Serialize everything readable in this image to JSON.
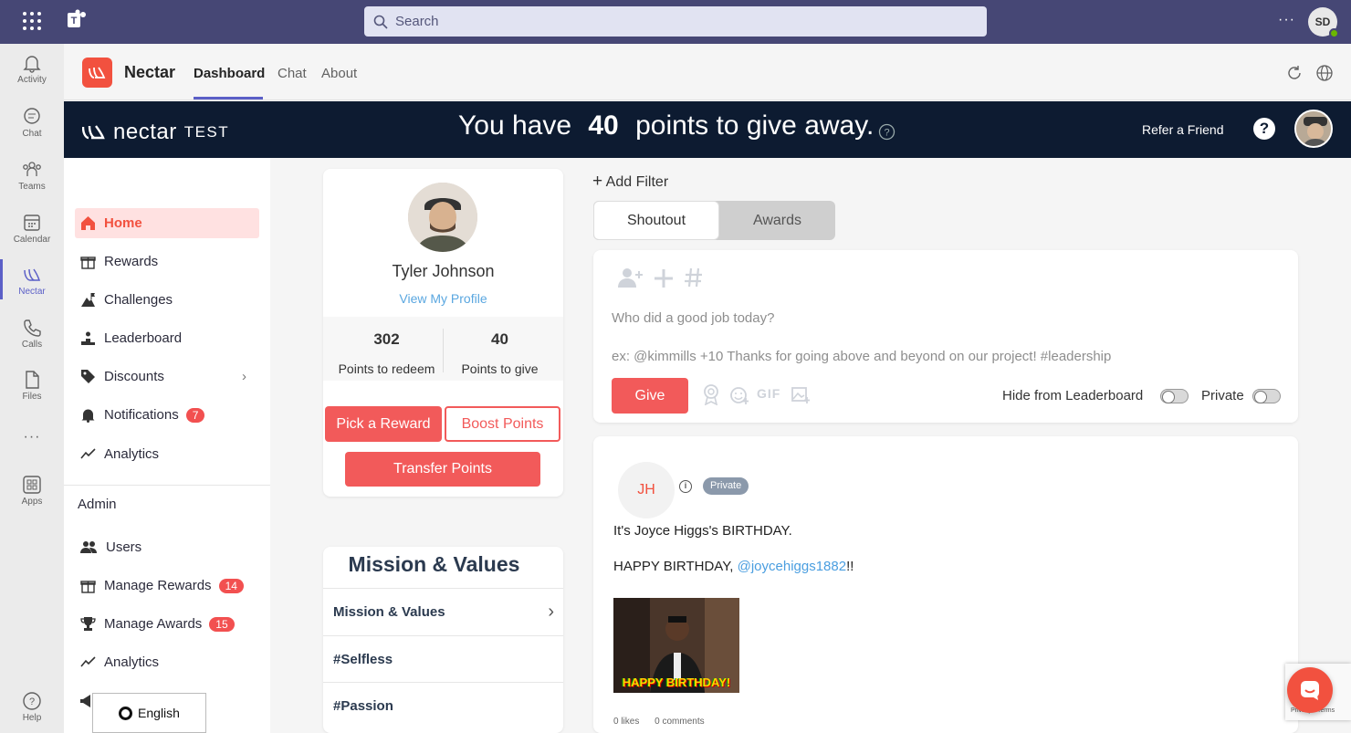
{
  "search": {
    "placeholder": "Search"
  },
  "user": {
    "initials": "SD"
  },
  "rail": [
    {
      "label": "Activity"
    },
    {
      "label": "Chat"
    },
    {
      "label": "Teams"
    },
    {
      "label": "Calendar"
    },
    {
      "label": "Nectar"
    },
    {
      "label": "Calls"
    },
    {
      "label": "Files"
    },
    {
      "label": "Apps"
    },
    {
      "label": "Help"
    }
  ],
  "app": {
    "name": "Nectar",
    "tabs": [
      "Dashboard",
      "Chat",
      "About"
    ]
  },
  "banner": {
    "logo_text": "nectar",
    "logo_suffix": "TEST",
    "title_pre": "You have",
    "points": "40",
    "title_post": "points to give away.",
    "refer": "Refer a Friend",
    "help": "?"
  },
  "sidebar": {
    "items": [
      {
        "label": "Home"
      },
      {
        "label": "Rewards"
      },
      {
        "label": "Challenges"
      },
      {
        "label": "Leaderboard"
      },
      {
        "label": "Discounts"
      },
      {
        "label": "Notifications",
        "badge": "7"
      },
      {
        "label": "Analytics"
      }
    ],
    "admin_label": "Admin",
    "admin_items": [
      {
        "label": "Users"
      },
      {
        "label": "Manage Rewards",
        "badge": "14"
      },
      {
        "label": "Manage Awards",
        "badge": "15"
      },
      {
        "label": "Analytics"
      }
    ],
    "language": "English"
  },
  "profile": {
    "name": "Tyler Johnson",
    "link": "View My Profile",
    "stats": [
      {
        "value": "302",
        "label": "Points to redeem"
      },
      {
        "value": "40",
        "label": "Points to give"
      }
    ],
    "buttons": {
      "pick": "Pick a Reward",
      "boost": "Boost Points",
      "transfer": "Transfer Points"
    }
  },
  "mission": {
    "title": "Mission & Values",
    "rows": [
      "Mission & Values",
      "#Selfless",
      "#Passion"
    ]
  },
  "feed": {
    "add_filter": "Add Filter",
    "segments": [
      "Shoutout",
      "Awards"
    ],
    "compose": {
      "placeholder": "Who did a good job today?",
      "example": "ex: @kimmills +10 Thanks for going above and beyond on our project! #leadership",
      "give": "Give",
      "gif": "GIF",
      "hide_label": "Hide from Leaderboard",
      "private_label": "Private"
    },
    "post": {
      "initials": "JH",
      "badge": "Private",
      "info": "i",
      "title": "It's Joyce Higgs's BIRTHDAY.",
      "body_pre": "HAPPY BIRTHDAY, ",
      "mention": "@joycehiggs1882",
      "body_post": "!!",
      "gif_text": "HAPPY BIRTHDAY!",
      "likes": "0 likes",
      "comments": "0 comments"
    }
  },
  "recaptcha": {
    "text": "Privacy - Terms"
  }
}
